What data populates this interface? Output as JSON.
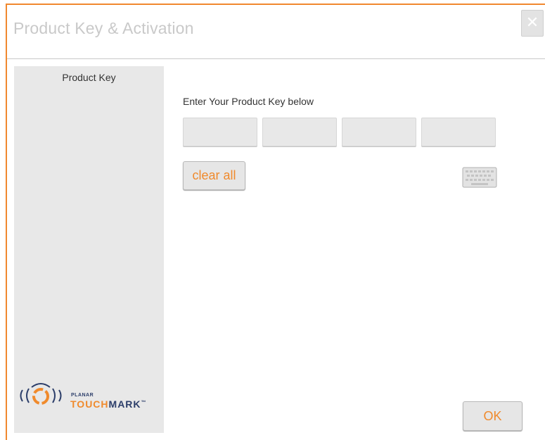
{
  "window": {
    "title": "Product Key & Activation",
    "close_symbol": "✕",
    "accent_color": "#f0882e"
  },
  "sidebar": {
    "items": [
      {
        "label": "Product Key",
        "selected": true
      }
    ],
    "logo": {
      "planar": "PLANAR",
      "word_accent": "TOUCH",
      "word_rest": "MARK",
      "trademark": "™"
    }
  },
  "main": {
    "prompt": "Enter Your Product Key below",
    "key_fields": [
      {
        "value": ""
      },
      {
        "value": ""
      },
      {
        "value": ""
      },
      {
        "value": ""
      }
    ],
    "clear_label": "clear all",
    "keyboard_icon": "keyboard-icon",
    "ok_label": "OK"
  }
}
